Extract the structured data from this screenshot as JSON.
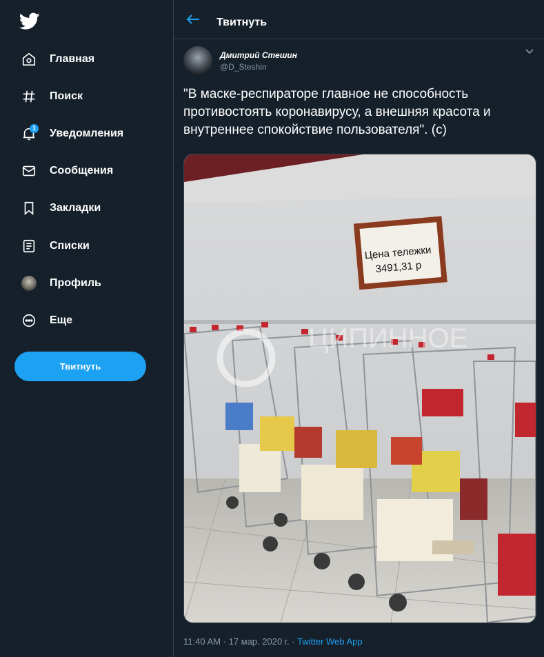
{
  "sidebar": {
    "items": [
      {
        "label": "Главная",
        "icon": "home-icon"
      },
      {
        "label": "Поиск",
        "icon": "hashtag-icon"
      },
      {
        "label": "Уведомления",
        "icon": "bell-icon",
        "badge": "1"
      },
      {
        "label": "Сообщения",
        "icon": "envelope-icon"
      },
      {
        "label": "Закладки",
        "icon": "bookmark-icon"
      },
      {
        "label": "Списки",
        "icon": "list-icon"
      },
      {
        "label": "Профиль",
        "icon": "avatar"
      },
      {
        "label": "Еще",
        "icon": "more-icon"
      }
    ],
    "tweet_button": "Твитнуть"
  },
  "header": {
    "title": "Твитнуть"
  },
  "tweet": {
    "author_name": "Дмитрий Стешин",
    "author_handle": "@D_Steshin",
    "text": "\"В маске-респираторе главное не способность противостоять коронавирусу, а внешняя красота и внутреннее спокойствие пользователя\". (c)",
    "image": {
      "sign_line1": "Цена тележки",
      "sign_line2": "3491,31 р",
      "watermark": "ЦИПИННОЕ"
    },
    "time": "11:40 AM",
    "date": "17 мар. 2020 г.",
    "separator": "·",
    "source": "Twitter Web App"
  },
  "colors": {
    "background": "#15202b",
    "accent": "#1da1f2",
    "divider": "#38444d",
    "muted": "#8899a6"
  }
}
